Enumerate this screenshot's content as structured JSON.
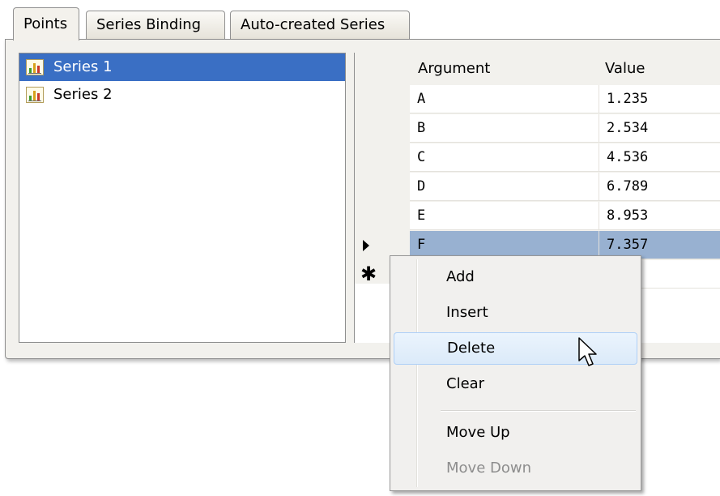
{
  "tabs": [
    {
      "label": "Points",
      "active": true
    },
    {
      "label": "Series Binding",
      "active": false
    },
    {
      "label": "Auto-created Series",
      "active": false
    }
  ],
  "series_list": [
    {
      "label": "Series 1",
      "icon": "bar-chart-icon",
      "selected": true
    },
    {
      "label": "Series 2",
      "icon": "bar-chart-icon",
      "selected": false
    }
  ],
  "grid": {
    "headers": {
      "argument": "Argument",
      "value": "Value"
    },
    "rows": [
      {
        "argument": "A",
        "value": "1.235"
      },
      {
        "argument": "B",
        "value": "2.534"
      },
      {
        "argument": "C",
        "value": "4.536"
      },
      {
        "argument": "D",
        "value": "6.789"
      },
      {
        "argument": "E",
        "value": "8.953"
      },
      {
        "argument": "F",
        "value": "7.357",
        "focused": true
      }
    ],
    "new_row_marker": "✱"
  },
  "context_menu": {
    "items": [
      {
        "label": "Add",
        "state": "normal"
      },
      {
        "label": "Insert",
        "state": "normal"
      },
      {
        "label": "Delete",
        "state": "hover"
      },
      {
        "label": "Clear",
        "state": "normal"
      },
      {
        "label": "Move Up",
        "state": "normal"
      },
      {
        "label": "Move Down",
        "state": "disabled"
      }
    ]
  },
  "colors": {
    "selection_blue": "#3a6fc4",
    "focused_row": "#98b1d1",
    "panel_bg": "#f2f1ed",
    "menu_hover": "#dbeaf9"
  }
}
